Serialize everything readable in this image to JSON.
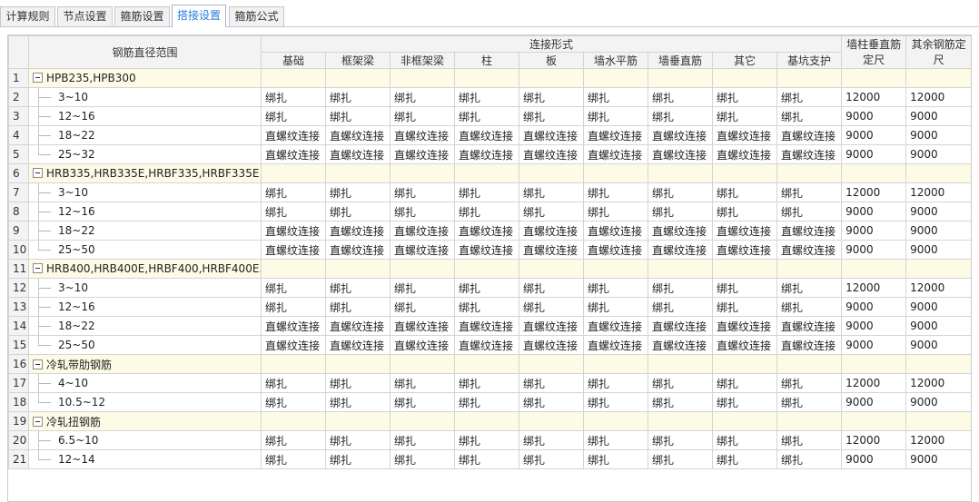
{
  "tabs": [
    {
      "label": "计算规则",
      "active": false
    },
    {
      "label": "节点设置",
      "active": false
    },
    {
      "label": "箍筋设置",
      "active": false
    },
    {
      "label": "搭接设置",
      "active": true
    },
    {
      "label": "箍筋公式",
      "active": false
    }
  ],
  "headers": {
    "range": "钢筋直径范围",
    "connection_group": "连接形式",
    "columns": [
      "基础",
      "框架梁",
      "非框架梁",
      "柱",
      "板",
      "墙水平筋",
      "墙垂直筋",
      "其它",
      "基坑支护"
    ],
    "wall_col_fixed": "墙柱垂直筋定尺",
    "other_fixed": "其余钢筋定尺"
  },
  "rows": [
    {
      "num": "1",
      "group": true,
      "name": "HPB235,HPB300"
    },
    {
      "num": "2",
      "name": "3~10",
      "values": [
        "绑扎",
        "绑扎",
        "绑扎",
        "绑扎",
        "绑扎",
        "绑扎",
        "绑扎",
        "绑扎",
        "绑扎"
      ],
      "fixed1": "12000",
      "fixed2": "12000"
    },
    {
      "num": "3",
      "name": "12~16",
      "values": [
        "绑扎",
        "绑扎",
        "绑扎",
        "绑扎",
        "绑扎",
        "绑扎",
        "绑扎",
        "绑扎",
        "绑扎"
      ],
      "fixed1": "9000",
      "fixed2": "9000"
    },
    {
      "num": "4",
      "name": "18~22",
      "values": [
        "直螺纹连接",
        "直螺纹连接",
        "直螺纹连接",
        "直螺纹连接",
        "直螺纹连接",
        "直螺纹连接",
        "直螺纹连接",
        "直螺纹连接",
        "直螺纹连接"
      ],
      "fixed1": "9000",
      "fixed2": "9000"
    },
    {
      "num": "5",
      "name": "25~32",
      "values": [
        "直螺纹连接",
        "直螺纹连接",
        "直螺纹连接",
        "直螺纹连接",
        "直螺纹连接",
        "直螺纹连接",
        "直螺纹连接",
        "直螺纹连接",
        "直螺纹连接"
      ],
      "fixed1": "9000",
      "fixed2": "9000",
      "last": true
    },
    {
      "num": "6",
      "group": true,
      "name": "HRB335,HRB335E,HRBF335,HRBF335E"
    },
    {
      "num": "7",
      "name": "3~10",
      "values": [
        "绑扎",
        "绑扎",
        "绑扎",
        "绑扎",
        "绑扎",
        "绑扎",
        "绑扎",
        "绑扎",
        "绑扎"
      ],
      "fixed1": "12000",
      "fixed2": "12000"
    },
    {
      "num": "8",
      "name": "12~16",
      "values": [
        "绑扎",
        "绑扎",
        "绑扎",
        "绑扎",
        "绑扎",
        "绑扎",
        "绑扎",
        "绑扎",
        "绑扎"
      ],
      "fixed1": "9000",
      "fixed2": "9000"
    },
    {
      "num": "9",
      "name": "18~22",
      "values": [
        "直螺纹连接",
        "直螺纹连接",
        "直螺纹连接",
        "直螺纹连接",
        "直螺纹连接",
        "直螺纹连接",
        "直螺纹连接",
        "直螺纹连接",
        "直螺纹连接"
      ],
      "fixed1": "9000",
      "fixed2": "9000"
    },
    {
      "num": "10",
      "name": "25~50",
      "values": [
        "直螺纹连接",
        "直螺纹连接",
        "直螺纹连接",
        "直螺纹连接",
        "直螺纹连接",
        "直螺纹连接",
        "直螺纹连接",
        "直螺纹连接",
        "直螺纹连接"
      ],
      "fixed1": "9000",
      "fixed2": "9000",
      "last": true
    },
    {
      "num": "11",
      "group": true,
      "name": "HRB400,HRB400E,HRBF400,HRBF400E..."
    },
    {
      "num": "12",
      "name": "3~10",
      "values": [
        "绑扎",
        "绑扎",
        "绑扎",
        "绑扎",
        "绑扎",
        "绑扎",
        "绑扎",
        "绑扎",
        "绑扎"
      ],
      "fixed1": "12000",
      "fixed2": "12000"
    },
    {
      "num": "13",
      "name": "12~16",
      "values": [
        "绑扎",
        "绑扎",
        "绑扎",
        "绑扎",
        "绑扎",
        "绑扎",
        "绑扎",
        "绑扎",
        "绑扎"
      ],
      "fixed1": "9000",
      "fixed2": "9000"
    },
    {
      "num": "14",
      "name": "18~22",
      "values": [
        "直螺纹连接",
        "直螺纹连接",
        "直螺纹连接",
        "直螺纹连接",
        "直螺纹连接",
        "直螺纹连接",
        "直螺纹连接",
        "直螺纹连接",
        "直螺纹连接"
      ],
      "fixed1": "9000",
      "fixed2": "9000"
    },
    {
      "num": "15",
      "name": "25~50",
      "values": [
        "直螺纹连接",
        "直螺纹连接",
        "直螺纹连接",
        "直螺纹连接",
        "直螺纹连接",
        "直螺纹连接",
        "直螺纹连接",
        "直螺纹连接",
        "直螺纹连接"
      ],
      "fixed1": "9000",
      "fixed2": "9000",
      "last": true
    },
    {
      "num": "16",
      "group": true,
      "name": "冷轧带肋钢筋"
    },
    {
      "num": "17",
      "name": "4~10",
      "values": [
        "绑扎",
        "绑扎",
        "绑扎",
        "绑扎",
        "绑扎",
        "绑扎",
        "绑扎",
        "绑扎",
        "绑扎"
      ],
      "fixed1": "12000",
      "fixed2": "12000"
    },
    {
      "num": "18",
      "name": "10.5~12",
      "values": [
        "绑扎",
        "绑扎",
        "绑扎",
        "绑扎",
        "绑扎",
        "绑扎",
        "绑扎",
        "绑扎",
        "绑扎"
      ],
      "fixed1": "9000",
      "fixed2": "9000",
      "last": true
    },
    {
      "num": "19",
      "group": true,
      "name": "冷轧扭钢筋"
    },
    {
      "num": "20",
      "name": "6.5~10",
      "values": [
        "绑扎",
        "绑扎",
        "绑扎",
        "绑扎",
        "绑扎",
        "绑扎",
        "绑扎",
        "绑扎",
        "绑扎"
      ],
      "fixed1": "12000",
      "fixed2": "12000"
    },
    {
      "num": "21",
      "name": "12~14",
      "values": [
        "绑扎",
        "绑扎",
        "绑扎",
        "绑扎",
        "绑扎",
        "绑扎",
        "绑扎",
        "绑扎",
        "绑扎"
      ],
      "fixed1": "9000",
      "fixed2": "9000",
      "last": true
    }
  ],
  "colors": {
    "accent": "#2a7de1",
    "group_bg": "#fdfbe6",
    "header_bg": "#f3f3f3"
  }
}
